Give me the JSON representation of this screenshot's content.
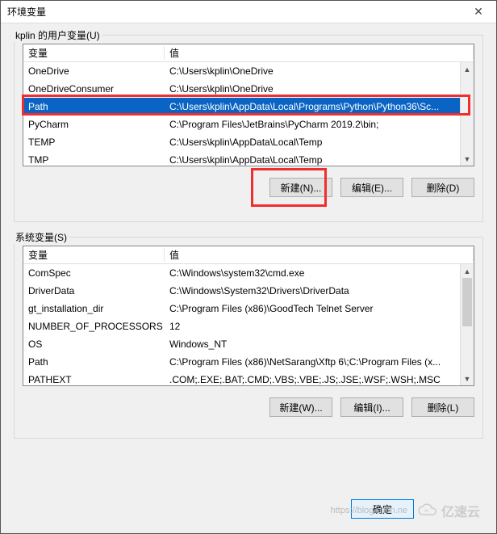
{
  "window": {
    "title": "环境变量"
  },
  "user_group": {
    "label": "kplin 的用户变量(U)",
    "header_var": "变量",
    "header_val": "值",
    "rows": [
      {
        "var": "OneDrive",
        "val": "C:\\Users\\kplin\\OneDrive",
        "selected": false
      },
      {
        "var": "OneDriveConsumer",
        "val": "C:\\Users\\kplin\\OneDrive",
        "selected": false
      },
      {
        "var": "Path",
        "val": "C:\\Users\\kplin\\AppData\\Local\\Programs\\Python\\Python36\\Sc...",
        "selected": true
      },
      {
        "var": "PyCharm",
        "val": "C:\\Program Files\\JetBrains\\PyCharm 2019.2\\bin;",
        "selected": false
      },
      {
        "var": "TEMP",
        "val": "C:\\Users\\kplin\\AppData\\Local\\Temp",
        "selected": false
      },
      {
        "var": "TMP",
        "val": "C:\\Users\\kplin\\AppData\\Local\\Temp",
        "selected": false
      }
    ],
    "btn_new": "新建(N)...",
    "btn_edit": "编辑(E)...",
    "btn_delete": "删除(D)"
  },
  "sys_group": {
    "label": "系统变量(S)",
    "header_var": "变量",
    "header_val": "值",
    "rows": [
      {
        "var": "ComSpec",
        "val": "C:\\Windows\\system32\\cmd.exe"
      },
      {
        "var": "DriverData",
        "val": "C:\\Windows\\System32\\Drivers\\DriverData"
      },
      {
        "var": "gt_installation_dir",
        "val": "C:\\Program Files (x86)\\GoodTech Telnet Server"
      },
      {
        "var": "NUMBER_OF_PROCESSORS",
        "val": "12"
      },
      {
        "var": "OS",
        "val": "Windows_NT"
      },
      {
        "var": "Path",
        "val": "C:\\Program Files (x86)\\NetSarang\\Xftp 6\\;C:\\Program Files (x..."
      },
      {
        "var": "PATHEXT",
        "val": ".COM;.EXE;.BAT;.CMD;.VBS;.VBE;.JS;.JSE;.WSF;.WSH;.MSC"
      }
    ],
    "btn_new": "新建(W)...",
    "btn_edit": "编辑(I)...",
    "btn_delete": "删除(L)"
  },
  "footer": {
    "ok": "确定",
    "cancel": ""
  },
  "watermark": {
    "text": "亿速云",
    "url": "https://blog.csdn.ne"
  }
}
